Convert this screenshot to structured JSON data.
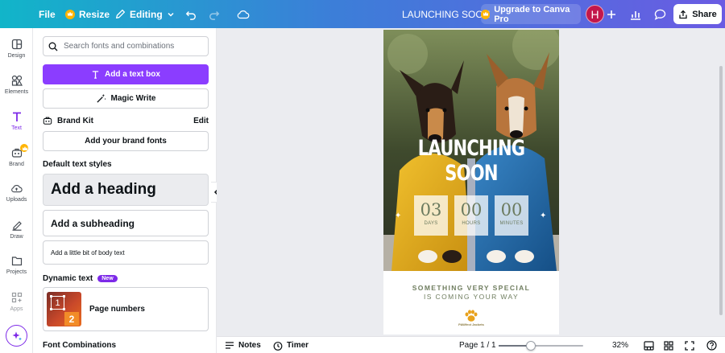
{
  "topbar": {
    "file_label": "File",
    "resize_label": "Resize",
    "editing_label": "Editing",
    "doc_title": "LAUNCHING SOON",
    "upgrade_label": "Upgrade to Canva Pro",
    "avatar_initial": "H",
    "share_label": "Share"
  },
  "rail": {
    "items": [
      {
        "label": "Design",
        "icon": "design-icon"
      },
      {
        "label": "Elements",
        "icon": "elements-icon"
      },
      {
        "label": "Text",
        "icon": "text-icon"
      },
      {
        "label": "Brand",
        "icon": "brand-icon"
      },
      {
        "label": "Uploads",
        "icon": "uploads-icon"
      },
      {
        "label": "Draw",
        "icon": "draw-icon"
      },
      {
        "label": "Projects",
        "icon": "projects-icon"
      },
      {
        "label": "Apps",
        "icon": "apps-icon"
      }
    ],
    "active": "Text"
  },
  "panel": {
    "search_placeholder": "Search fonts and combinations",
    "add_text_box": "Add a text box",
    "magic_write": "Magic Write",
    "brand_kit": "Brand Kit",
    "brand_kit_edit": "Edit",
    "add_brand_fonts": "Add your brand fonts",
    "default_styles_title": "Default text styles",
    "heading": "Add a heading",
    "subheading": "Add a subheading",
    "body": "Add a little bit of body text",
    "dynamic_text_title": "Dynamic text",
    "new_badge": "New",
    "page_numbers": "Page numbers",
    "page_numbers_thumb": {
      "n1": "1",
      "n2": "2"
    },
    "font_combinations_title": "Font Combinations"
  },
  "poster": {
    "title_line1": "LAUNCHING",
    "title_line2": "SOON",
    "countdown": [
      {
        "value": "03",
        "label": "DAYS"
      },
      {
        "value": "00",
        "label": "HOURS"
      },
      {
        "value": "00",
        "label": "MINUTES"
      }
    ],
    "tagline1": "SOMETHING VERY SPECIAL",
    "tagline2": "IS COMING YOUR WAY",
    "logo_text": "PAWfect Jackets",
    "accent_color": "#6f7d5f"
  },
  "bottombar": {
    "notes_label": "Notes",
    "timer_label": "Timer",
    "page_indicator": "Page 1 / 1",
    "zoom_percent": "32%",
    "zoom_slider_fraction": 0.38
  },
  "colors": {
    "brand_purple": "#8b3dff",
    "avatar": "#c3174b",
    "topbar_start": "#11b5c9",
    "topbar_end": "#6a5be3"
  }
}
